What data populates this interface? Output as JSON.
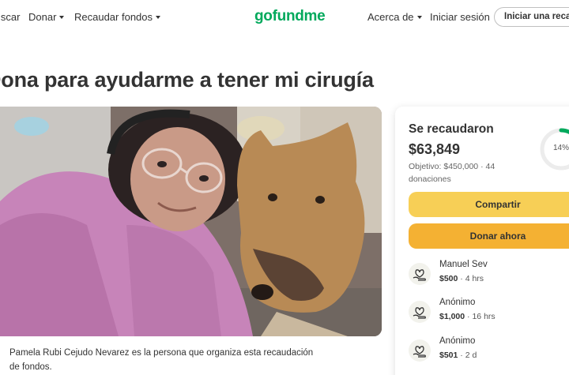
{
  "header": {
    "search_label": "Buscar",
    "donate_label": "Donar",
    "fundraise_label": "Recaudar fondos",
    "logo_text": "gofundme",
    "about_label": "Acerca de",
    "signin_label": "Iniciar sesión",
    "start_label": "Iniciar una recaudación"
  },
  "campaign": {
    "title": "Dona para ayudarme a tener mi cirugía",
    "organizer_text": "Pamela Rubi Cejudo Nevarez es la persona que organiza esta recaudación de fondos."
  },
  "donation_card": {
    "raised_label": "Se recaudaron",
    "raised_amount": "$63,849",
    "goal_text": "Objetivo: $450,000 · 44 donaciones",
    "progress_percent_text": "14%",
    "progress_fraction": 0.14,
    "share_label": "Compartir",
    "donate_label": "Donar ahora",
    "donors": [
      {
        "name": "Manuel Sev",
        "amount": "$500",
        "time": "4 hrs"
      },
      {
        "name": "Anónimo",
        "amount": "$1,000",
        "time": "16 hrs"
      },
      {
        "name": "Anónimo",
        "amount": "$501",
        "time": "2 d"
      }
    ]
  },
  "colors": {
    "brand_green": "#02a95c",
    "share_button": "#f7cf56",
    "donate_button": "#f4b133"
  },
  "icons": {
    "donor": "heart-hand-icon",
    "caret": "chevron-down-icon"
  }
}
